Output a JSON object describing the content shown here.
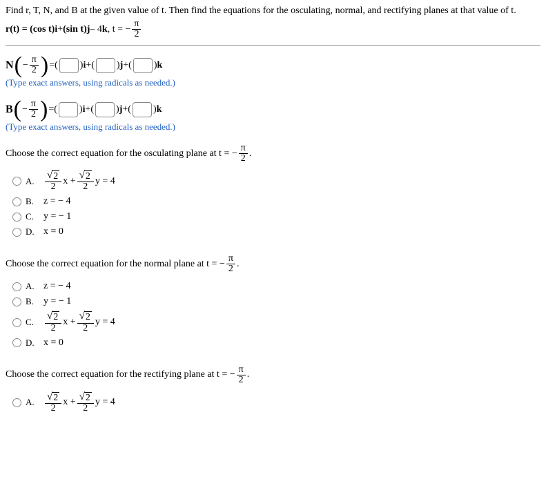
{
  "intro": "Find r, T, N, and B at the given value of t. Then find the equations for the osculating, normal, and rectifying planes at that value of t.",
  "rt_prefix": "r(t) = (cos t)",
  "i": "i",
  "plus": " + ",
  "rt_mid": "(sin t)",
  "j": "j",
  "rt_suf": " – 4",
  "k": "k",
  "comma_t": ",   t =  − ",
  "pi": "π",
  "two": "2",
  "N_label": "N",
  "B_label": "B",
  "eq": " = ",
  "lparen": "(",
  "rparen": ")",
  "hint": "(Type exact answers, using radicals as needed.)",
  "q_osc_a": "Choose the correct equation for the osculating plane at t =  − ",
  "q_norm_a": "Choose the correct equation for the normal plane at t =  − ",
  "q_rect_a": "Choose the correct equation for the rectifying plane at t =  − ",
  "period": ".",
  "optA": "A.",
  "optB": "B.",
  "optC": "C.",
  "optD": "D.",
  "sqrt2": "2",
  "x_plus": "x + ",
  "y_eq_4": "y = 4",
  "z_eq_neg4": "z =  − 4",
  "y_eq_neg1": "y =  − 1",
  "x_eq_0": "x = 0"
}
